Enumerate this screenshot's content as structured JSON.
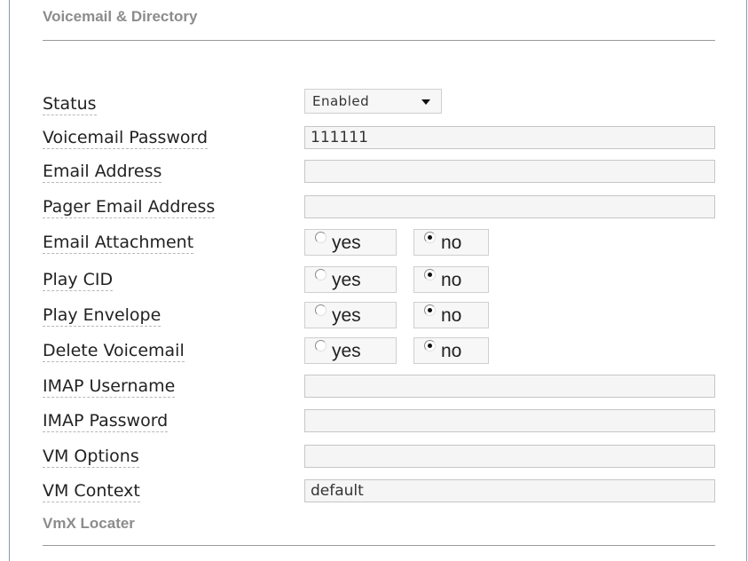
{
  "section": {
    "title": "Voicemail & Directory"
  },
  "fields": {
    "status": {
      "label": "Status",
      "value": "Enabled"
    },
    "voicemail_password": {
      "label": "Voicemail Password",
      "value": "111111"
    },
    "email_address": {
      "label": "Email Address",
      "value": ""
    },
    "pager_email_address": {
      "label": "Pager Email Address",
      "value": ""
    },
    "email_attachment": {
      "label": "Email Attachment",
      "yes": "yes",
      "no": "no",
      "selected": "no"
    },
    "play_cid": {
      "label": "Play CID",
      "yes": "yes",
      "no": "no",
      "selected": "no"
    },
    "play_envelope": {
      "label": "Play Envelope",
      "yes": "yes",
      "no": "no",
      "selected": "no"
    },
    "delete_voicemail": {
      "label": "Delete Voicemail",
      "yes": "yes",
      "no": "no",
      "selected": "no"
    },
    "imap_username": {
      "label": "IMAP Username",
      "value": ""
    },
    "imap_password": {
      "label": "IMAP Password",
      "value": ""
    },
    "vm_options": {
      "label": "VM Options",
      "value": ""
    },
    "vm_context": {
      "label": "VM Context",
      "value": "default"
    }
  },
  "vmx": {
    "title": "VmX Locater"
  }
}
